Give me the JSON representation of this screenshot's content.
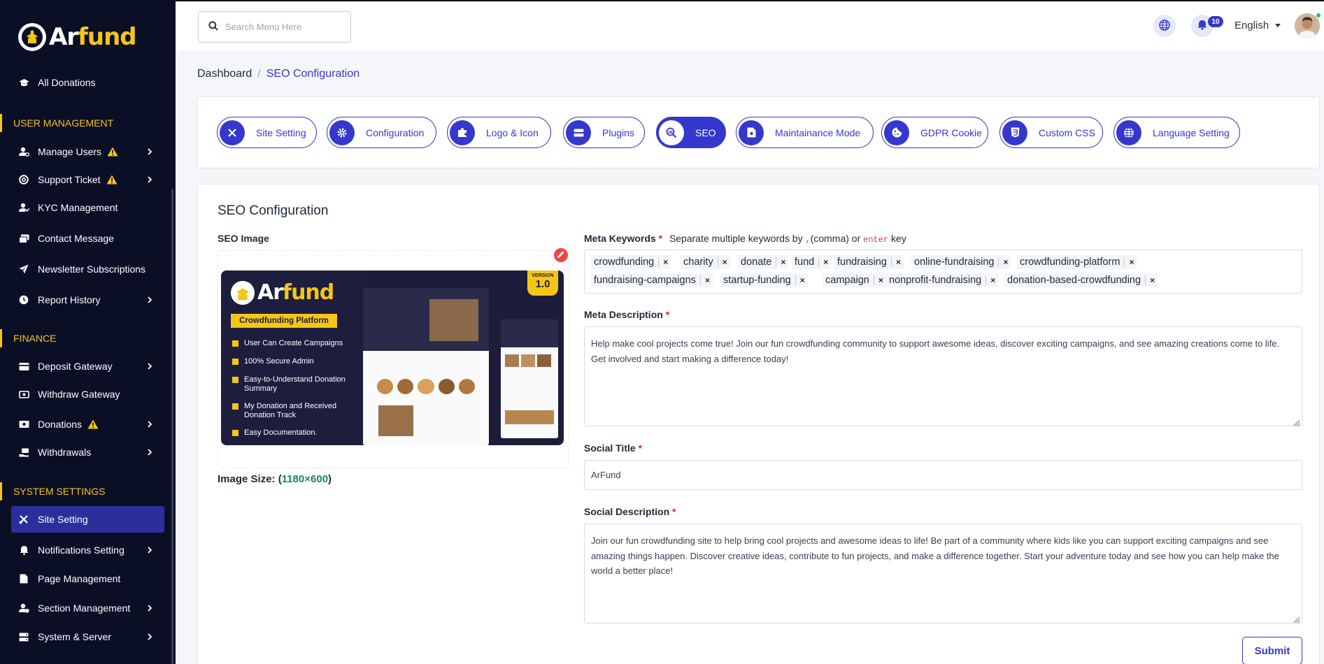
{
  "brand": {
    "logo_part1": "Ar",
    "logo_part2": "fund"
  },
  "sidebar": {
    "all_donations": "All Donations",
    "sections": {
      "user_management": "USER MANAGEMENT",
      "finance": "FINANCE",
      "system_settings": "SYSTEM SETTINGS"
    },
    "items": {
      "manage_users": "Manage Users",
      "support_ticket": "Support Ticket",
      "kyc": "KYC Management",
      "contact": "Contact Message",
      "newsletter": "Newsletter Subscriptions",
      "report": "Report History",
      "deposit": "Deposit Gateway",
      "withdraw_gw": "Withdraw Gateway",
      "donations": "Donations",
      "withdrawals": "Withdrawals",
      "site_setting": "Site Setting",
      "notifications": "Notifications Setting",
      "page_mgmt": "Page Management",
      "section_mgmt": "Section Management",
      "system_server": "System & Server"
    }
  },
  "topbar": {
    "search_placeholder": "Search Menu Here",
    "notification_count": "10",
    "language": "English"
  },
  "breadcrumb": {
    "root": "Dashboard",
    "separator": "/",
    "current": "SEO Configuration"
  },
  "tabs": {
    "site_setting": "Site Setting",
    "configuration": "Configuration",
    "logo_icon": "Logo & Icon",
    "plugins": "Plugins",
    "seo": "SEO",
    "maintenance": "Maintainance Mode",
    "gdpr": "GDPR Cookie",
    "custom_css": "Custom CSS",
    "language_setting": "Language Setting"
  },
  "form": {
    "title": "SEO Configuration",
    "seo_image_label": "SEO Image",
    "image_size_label": "Image Size: (",
    "image_size_value": "1180×600",
    "image_size_close": ")",
    "meta_keywords_label": "Meta Keywords",
    "required_mark": "*",
    "keywords_hint_prefix": "Separate multiple keywords by",
    "keywords_hint_comma": ",",
    "keywords_hint_middle": "(comma) or",
    "keywords_hint_enter": "enter",
    "keywords_hint_suffix": "key",
    "keywords": [
      "crowdfunding",
      "charity",
      "donate",
      "fund",
      "fundraising",
      "online-fundraising",
      "crowdfunding-platform",
      "fundraising-campaigns",
      "startup-funding",
      "campaign",
      "nonprofit-fundraising",
      "donation-based-crowdfunding"
    ],
    "tag_remove": "×",
    "meta_description_label": "Meta Description",
    "meta_description": "Help make cool projects come true! Join our fun crowdfunding community to support awesome ideas, discover exciting campaigns, and see amazing creations come to life. Get involved and start making a difference today!",
    "social_title_label": "Social Title",
    "social_title": "ArFund",
    "social_description_label": "Social Description",
    "social_description": "Join our fun crowdfunding site to help bring cool projects and awesome ideas to life! Be part of a community where kids like you can support exciting campaigns and see amazing things happen. Discover creative ideas, contribute to fun projects, and make a difference together. Start your adventure today and see how you can help make the world a better place!",
    "submit": "Submit"
  },
  "preview": {
    "logo_part1": "Ar",
    "logo_part2": "fund",
    "banner": "Crowdfunding Platform",
    "version_label": "VERSION",
    "version": "1.0",
    "features": [
      "User Can Create Campaigns",
      "100% Secure Admin",
      "Easy-to-Understand Donation Summary",
      "My Donation and Received Donation Track",
      "Easy Documentation."
    ]
  },
  "colors": {
    "sidebar_bg": "#0a0f26",
    "accent": "#3538cd",
    "brand_yellow": "#f5c518",
    "required": "#dc2626",
    "size_green": "#198754"
  }
}
